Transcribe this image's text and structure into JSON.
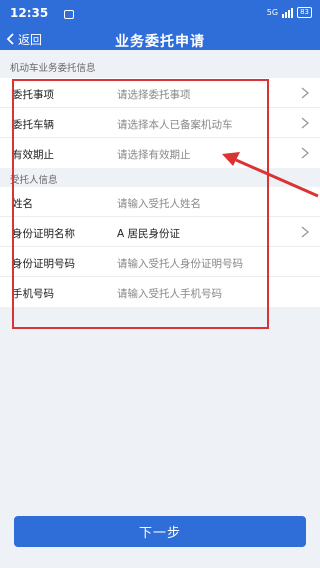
{
  "status_bar": {
    "time": "12:35",
    "network": "5G",
    "battery": "83"
  },
  "nav": {
    "back_label": "返回",
    "title": "业务委托申请"
  },
  "vehicle_section": {
    "title": "机动车业务委托信息",
    "rows": [
      {
        "label": "委托事项",
        "value": "请选择委托事项",
        "has_arrow": true
      },
      {
        "label": "委托车辆",
        "value": "请选择本人已备案机动车",
        "has_arrow": true
      },
      {
        "label": "有效期止",
        "value": "请选择有效期止",
        "has_arrow": true
      }
    ]
  },
  "trustee_section": {
    "title": "受托人信息",
    "rows": [
      {
        "label": "姓名",
        "value": "请输入受托人姓名"
      },
      {
        "label": "身份证明名称",
        "value": "A 居民身份证",
        "has_arrow": true
      },
      {
        "label": "身份证明号码",
        "value": "请输入受托人身份证明号码"
      },
      {
        "label": "手机号码",
        "value": "请输入受托人手机号码"
      }
    ]
  },
  "footer": {
    "next_label": "下一步"
  },
  "colors": {
    "primary": "#2f6dd8",
    "annotation": "#d93333",
    "background": "#eef1f5"
  }
}
